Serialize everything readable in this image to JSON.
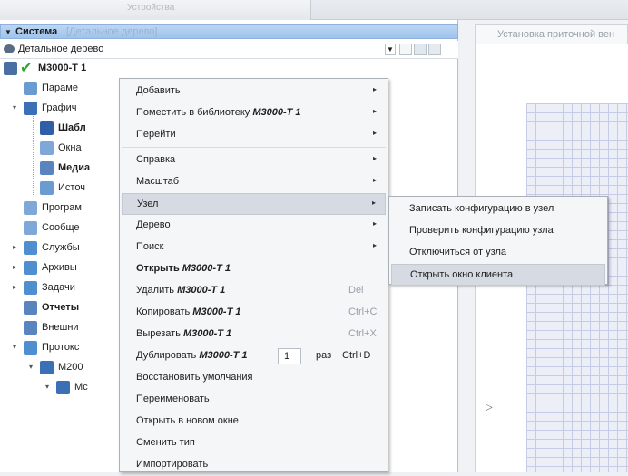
{
  "top": {
    "tab_label": "Устройства"
  },
  "left": {
    "system_title": "Система",
    "system_hint": "[Детальное дерево]",
    "tree_view_label": "Детальное дерево",
    "tree": [
      {
        "label": "M3000-T 1",
        "icon": "device-icon",
        "color": "#4a6fa5"
      },
      {
        "label": "Параме",
        "icon": "params-icon",
        "color": "#6a9bd1"
      },
      {
        "label": "Графич",
        "icon": "graphics-icon",
        "color": "#3b6fb6"
      },
      {
        "label": "Шабл",
        "icon": "template-icon",
        "color": "#2f5fa6"
      },
      {
        "label": "Окна",
        "icon": "window-icon",
        "color": "#7fa8d8"
      },
      {
        "label": "Медиа",
        "icon": "media-icon",
        "color": "#5a84c0"
      },
      {
        "label": "Источ",
        "icon": "source-icon",
        "color": "#6a9bd1"
      },
      {
        "label": "Програм",
        "icon": "program-icon",
        "color": "#7fa8d8"
      },
      {
        "label": "Сообще",
        "icon": "message-icon",
        "color": "#7fa8d8"
      },
      {
        "label": "Службы",
        "icon": "services-icon",
        "color": "#4f8fcf"
      },
      {
        "label": "Архивы",
        "icon": "archive-icon",
        "color": "#4f8fcf"
      },
      {
        "label": "Задачи",
        "icon": "tasks-icon",
        "color": "#4f8fcf"
      },
      {
        "label": "Отчеты",
        "icon": "reports-icon",
        "color": "#5a84c0"
      },
      {
        "label": "Внешни",
        "icon": "external-icon",
        "color": "#5a84c0"
      },
      {
        "label": "Протокс",
        "icon": "protocol-icon",
        "color": "#4f8fcf"
      },
      {
        "label": "M200",
        "icon": "module-icon",
        "color": "#3b6fb6"
      },
      {
        "label": "Мс",
        "icon": "module-sub-icon",
        "color": "#3b6fb6"
      }
    ]
  },
  "right": {
    "tab_title": "Установка приточной вен"
  },
  "context_menu": {
    "items": [
      {
        "label": "Добавить",
        "arrow": true
      },
      {
        "label": "Поместить в библиотеку ",
        "em": "M3000-T 1",
        "arrow": true
      },
      {
        "label": "Перейти",
        "arrow": true
      },
      {
        "label": "Справка",
        "arrow": true
      },
      {
        "label": "Масштаб",
        "arrow": true
      },
      {
        "label": "Узел",
        "arrow": true,
        "highlighted": true
      },
      {
        "label": "Дерево",
        "arrow": true
      },
      {
        "label": "Поиск",
        "arrow": true
      },
      {
        "label": "Открыть ",
        "em": "M3000-T 1",
        "bold": true
      },
      {
        "label": "Удалить ",
        "em": "M3000-T 1",
        "shortcut": "Del"
      },
      {
        "label": "Копировать ",
        "em": "M3000-T 1",
        "shortcut": "Ctrl+C"
      },
      {
        "label": "Вырезать ",
        "em": "M3000-T 1",
        "shortcut": "Ctrl+X"
      },
      {
        "label": "Дублировать ",
        "em": "M3000-T 1",
        "spin_value": "1",
        "suffix": "раз",
        "shortcut": "Ctrl+D"
      },
      {
        "label": "Восстановить умолчания"
      },
      {
        "label": "Переименовать"
      },
      {
        "label": "Открыть в новом окне"
      },
      {
        "label": "Сменить тип"
      },
      {
        "label": "Импортировать"
      }
    ]
  },
  "submenu": {
    "items": [
      {
        "label": "Записать конфигурацию в узел"
      },
      {
        "label": "Проверить конфигурацию узла"
      },
      {
        "label": "Отключиться от узла"
      },
      {
        "label": "Открыть окно клиента",
        "highlighted": true
      }
    ]
  },
  "colors": {
    "selection": "#d6dae2",
    "accent_bar": "#9fc3ec",
    "grid": "#c6cbe6"
  }
}
